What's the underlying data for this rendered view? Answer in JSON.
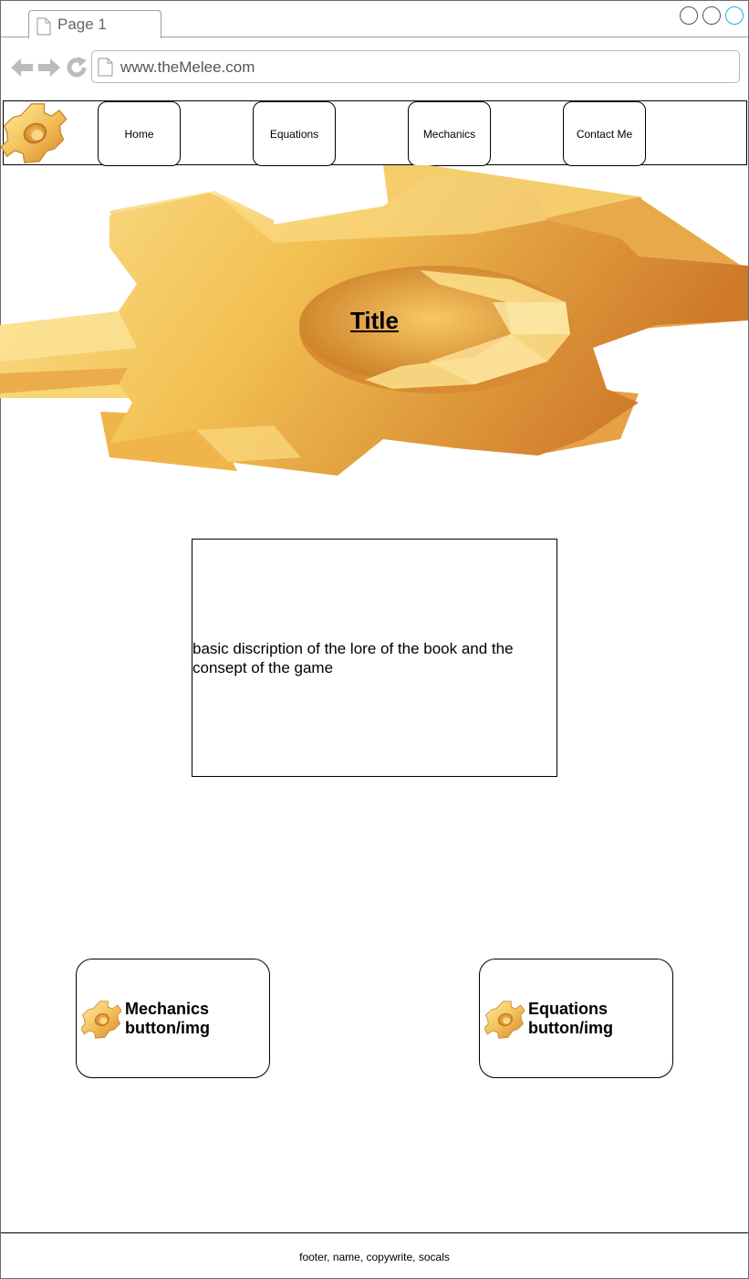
{
  "browser": {
    "tab_title": "Page 1",
    "url": "www.theMelee.com"
  },
  "nav": {
    "items": [
      {
        "label": "Home"
      },
      {
        "label": "Equations"
      },
      {
        "label": "Mechanics"
      },
      {
        "label": "Contact Me"
      }
    ]
  },
  "hero": {
    "title": "Title"
  },
  "description": {
    "text": "basic discription of the lore of the book and the consept of the game"
  },
  "cards": [
    {
      "label_line1": "Mechanics",
      "label_line2": "button/img"
    },
    {
      "label_line1": "Equations",
      "label_line2": "button/img"
    }
  ],
  "footer": {
    "text": "footer, name, copywrite, socals"
  },
  "colors": {
    "gear_light": "#fbe39a",
    "gear_mid": "#f3c35a",
    "gear_dark": "#d9882e",
    "window_active": "#29a9e8"
  }
}
